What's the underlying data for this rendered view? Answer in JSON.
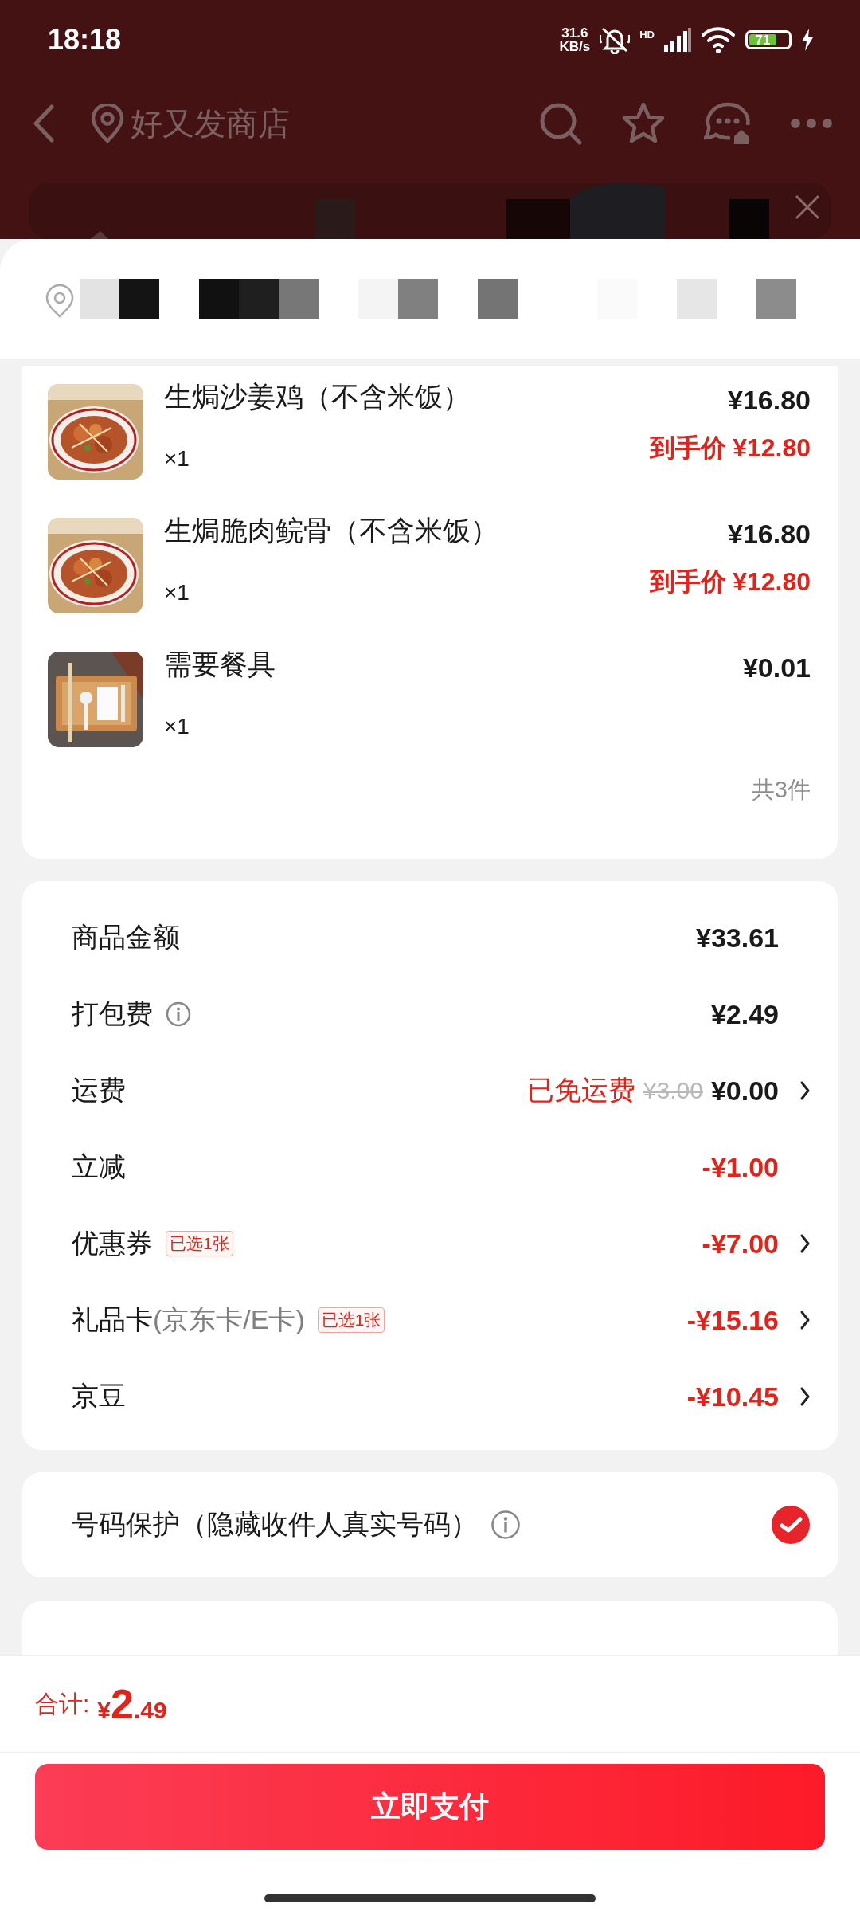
{
  "status_bar": {
    "time": "18:18",
    "speed": "31.6",
    "speed_unit": "KB/s",
    "signal_label": "HD",
    "battery": "71"
  },
  "nav": {
    "store_name": "好又发商店"
  },
  "items": [
    {
      "name": "生焗沙姜鸡（不含米饭）",
      "quantity": "×1",
      "price": "¥16.80",
      "final_label": "到手价",
      "final_price": "¥12.80",
      "kind": "dish"
    },
    {
      "name": "生焗脆肉鲩骨（不含米饭）",
      "quantity": "×1",
      "price": "¥16.80",
      "final_label": "到手价",
      "final_price": "¥12.80",
      "kind": "dish"
    },
    {
      "name": "需要餐具",
      "quantity": "×1",
      "price": "¥0.01",
      "kind": "cutlery"
    }
  ],
  "item_count": "共3件",
  "fees": [
    {
      "label": "商品金额",
      "value": "¥33.61",
      "deduction": false,
      "arrow": false,
      "info": false
    },
    {
      "label": "打包费",
      "value": "¥2.49",
      "deduction": false,
      "arrow": false,
      "info": true
    },
    {
      "label": "运费",
      "note": "已免运费",
      "original": "¥3.00",
      "value": "¥0.00",
      "deduction": false,
      "arrow": true,
      "info": false
    },
    {
      "label": "立减",
      "value": "-¥1.00",
      "deduction": true,
      "arrow": false,
      "info": false
    },
    {
      "label": "优惠券",
      "tag": "已选1张",
      "value": "-¥7.00",
      "deduction": true,
      "arrow": true,
      "info": false
    },
    {
      "label": "礼品卡",
      "sublabel": "(京东卡/E卡)",
      "tag": "已选1张",
      "value": "-¥15.16",
      "deduction": true,
      "arrow": true,
      "info": false
    },
    {
      "label": "京豆",
      "value": "-¥10.45",
      "deduction": true,
      "arrow": true,
      "info": false
    }
  ],
  "protection": {
    "label": "号码保护（隐藏收件人真实号码）",
    "checked": true
  },
  "total": {
    "label": "合计:",
    "currency": "¥",
    "integer": "2",
    "decimal": ".49"
  },
  "pay_button": "立即支付"
}
